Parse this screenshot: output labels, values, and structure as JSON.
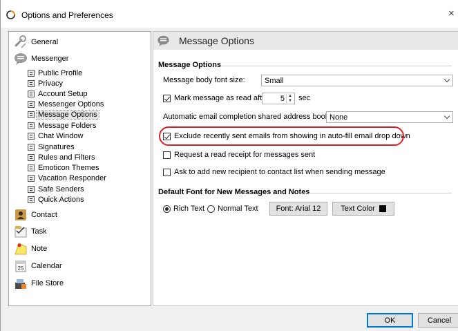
{
  "window": {
    "title": "Options and Preferences",
    "close_glyph": "×"
  },
  "sidebar": {
    "top_items": [
      {
        "label": "General",
        "icon": "wrench-icon"
      },
      {
        "label": "Messenger",
        "icon": "speech-bubble-icon"
      }
    ],
    "messenger_items": [
      "Public Profile",
      "Privacy",
      "Account Setup",
      "Messenger Options",
      "Message Options",
      "Message Folders",
      "Chat Window",
      "Signatures",
      "Rules and Filters",
      "Emoticon Themes",
      "Vacation Responder",
      "Safe Senders",
      "Quick Actions"
    ],
    "selected": "Message Options",
    "bottom_items": [
      {
        "label": "Contact",
        "icon": "contact-icon"
      },
      {
        "label": "Task",
        "icon": "task-icon"
      },
      {
        "label": "Note",
        "icon": "note-icon"
      },
      {
        "label": "Calendar",
        "icon": "calendar-icon"
      },
      {
        "label": "File Store",
        "icon": "file-store-icon"
      }
    ],
    "calendar_icon_number": "25"
  },
  "panel": {
    "header": "Message Options",
    "group1_title": "Message Options",
    "font_size_label": "Message body font size:",
    "font_size_value": "Small",
    "mark_read_label": "Mark message as read after",
    "mark_read_checked": true,
    "mark_read_value": "5",
    "mark_read_unit": "sec",
    "address_book_label": "Automatic email completion shared address book:",
    "address_book_value": "None",
    "exclude_label": "Exclude recently sent emails from showing in auto-fill email drop down",
    "exclude_checked": true,
    "read_receipt_label": "Request a read receipt for messages sent",
    "read_receipt_checked": false,
    "add_recipient_label": "Ask to add new recipient to contact list when sending message",
    "add_recipient_checked": false,
    "group2_title": "Default Font for New Messages and Notes",
    "rich_text_label": "Rich Text",
    "normal_text_label": "Normal Text",
    "selected_format": "Rich Text",
    "font_button_label": "Font: Arial 12",
    "text_color_label": "Text Color",
    "text_color": "#000000"
  },
  "footer": {
    "ok_label": "OK",
    "cancel_label": "Cancel"
  },
  "colors": {
    "highlight_ring": "#d81f26",
    "default_button_border": "#0078d7"
  }
}
